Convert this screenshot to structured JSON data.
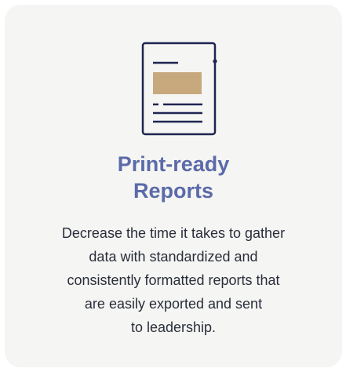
{
  "card": {
    "icon": "document-report-icon",
    "colors": {
      "background": "#f5f5f3",
      "title": "#5b6aa9",
      "icon_stroke": "#1f2552",
      "icon_fill": "#c8a97e"
    },
    "title_lines": [
      "Print-ready",
      "Reports"
    ],
    "description_lines": [
      "Decrease the time it takes to gather",
      "data with standardized and",
      "consistently formatted reports that",
      "are easily exported and sent",
      "to leadership."
    ]
  }
}
